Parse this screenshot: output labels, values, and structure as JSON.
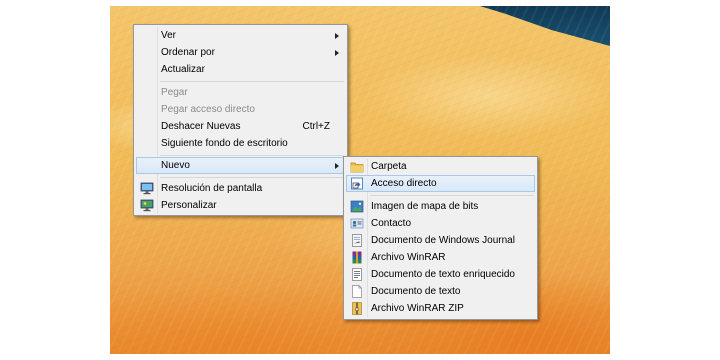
{
  "context_menu": {
    "items": [
      {
        "label": "Ver",
        "submenu": true
      },
      {
        "label": "Ordenar por",
        "submenu": true
      },
      {
        "label": "Actualizar"
      },
      {
        "label": "Pegar",
        "disabled": true
      },
      {
        "label": "Pegar acceso directo",
        "disabled": true
      },
      {
        "label": "Deshacer Nuevas",
        "shortcut": "Ctrl+Z"
      },
      {
        "label": "Siguiente fondo de escritorio"
      },
      {
        "label": "Nuevo",
        "submenu": true,
        "highlighted": true
      },
      {
        "label": "Resolución de pantalla",
        "icon": "display-settings-icon"
      },
      {
        "label": "Personalizar",
        "icon": "personalize-icon"
      }
    ]
  },
  "new_submenu": {
    "items": [
      {
        "label": "Carpeta",
        "icon": "folder-icon"
      },
      {
        "label": "Acceso directo",
        "icon": "shortcut-icon",
        "highlighted": true
      },
      {
        "label": "Imagen de mapa de bits",
        "icon": "bitmap-image-icon"
      },
      {
        "label": "Contacto",
        "icon": "contact-icon"
      },
      {
        "label": "Documento de Windows Journal",
        "icon": "journal-document-icon"
      },
      {
        "label": "Archivo WinRAR",
        "icon": "winrar-archive-icon"
      },
      {
        "label": "Documento de texto enriquecido",
        "icon": "rich-text-document-icon"
      },
      {
        "label": "Documento de texto",
        "icon": "text-document-icon"
      },
      {
        "label": "Archivo WinRAR ZIP",
        "icon": "winrar-zip-icon"
      }
    ]
  },
  "colors": {
    "menu_background": "#f0f0f0",
    "highlight_fill": "#dde9f7",
    "highlight_border": "#aac8ea",
    "disabled_text": "#8a8a8a"
  }
}
